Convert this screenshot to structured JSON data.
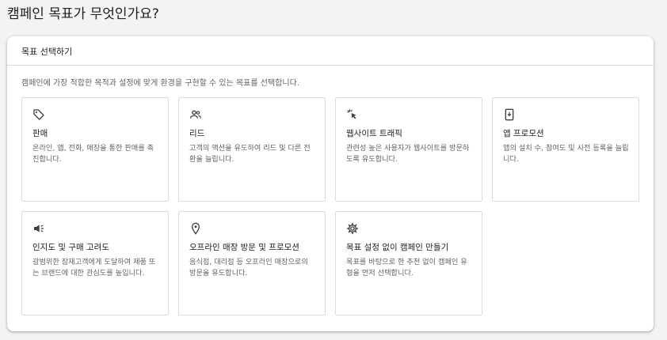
{
  "page": {
    "title": "캠페인 목표가 무엇인가요?"
  },
  "card": {
    "header": "목표 선택하기",
    "description": "캠페인에 가장 적합한 목적과 설정에 맞게 환경을 구현할 수 있는 목표를 선택합니다."
  },
  "goals": [
    {
      "icon": "tag-icon",
      "title": "판매",
      "description": "온라인, 앱, 전화, 매장을 통한 판매를 촉진합니다."
    },
    {
      "icon": "people-icon",
      "title": "리드",
      "description": "고객의 액션을 유도하여 리드 및 다른 전환을 늘립니다."
    },
    {
      "icon": "cursor-click-icon",
      "title": "웹사이트 트래픽",
      "description": "관련성 높은 사용자가 웹사이트를 방문하도록 유도합니다."
    },
    {
      "icon": "phone-download-icon",
      "title": "앱 프로모션",
      "description": "앱의 설치 수, 참여도 및 사전 등록을 늘립니다."
    },
    {
      "icon": "megaphone-icon",
      "title": "인지도 및 구매 고려도",
      "description": "광범위한 잠재고객에게 도달하여 제품 또는 브랜드에 대한 관심도를 높입니다."
    },
    {
      "icon": "location-pin-icon",
      "title": "오프라인 매장 방문 및 프로모션",
      "description": "음식점, 대리점 등 오프라인 매장으로의 방문을 유도합니다."
    },
    {
      "icon": "gear-icon",
      "title": "목표 설정 없이 캠페인 만들기",
      "description": "목표를 바탕으로 한 추천 없이 캠페인 유형을 먼저 선택합니다."
    }
  ]
}
